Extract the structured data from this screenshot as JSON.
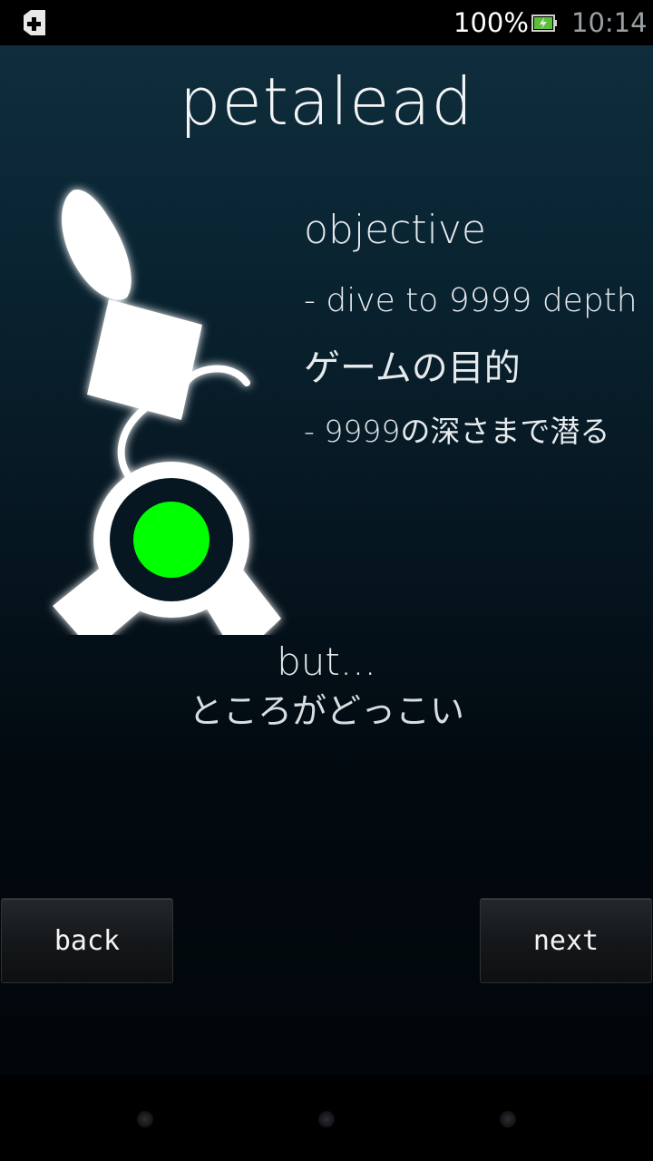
{
  "status_bar": {
    "battery_percent": "100%",
    "time": "10:14",
    "left_icon": "plus-badge-icon",
    "battery_icon": "battery-charging-icon"
  },
  "app": {
    "title": "petalead",
    "objective_heading": "objective",
    "objective_line": "- dive to 9999 depth",
    "ja_heading": "ゲームの目的",
    "ja_line": "- 9999の深さまで潜る",
    "but_text": "but...",
    "but_ja": "ところがどっこい",
    "mascot_icon": "petalead-creature-icon",
    "mascot_eye_color": "#00ff00"
  },
  "buttons": {
    "back": "back",
    "next": "next"
  },
  "system_nav": {
    "items": [
      "back-dot-icon",
      "home-dot-icon",
      "menu-dot-icon"
    ]
  }
}
